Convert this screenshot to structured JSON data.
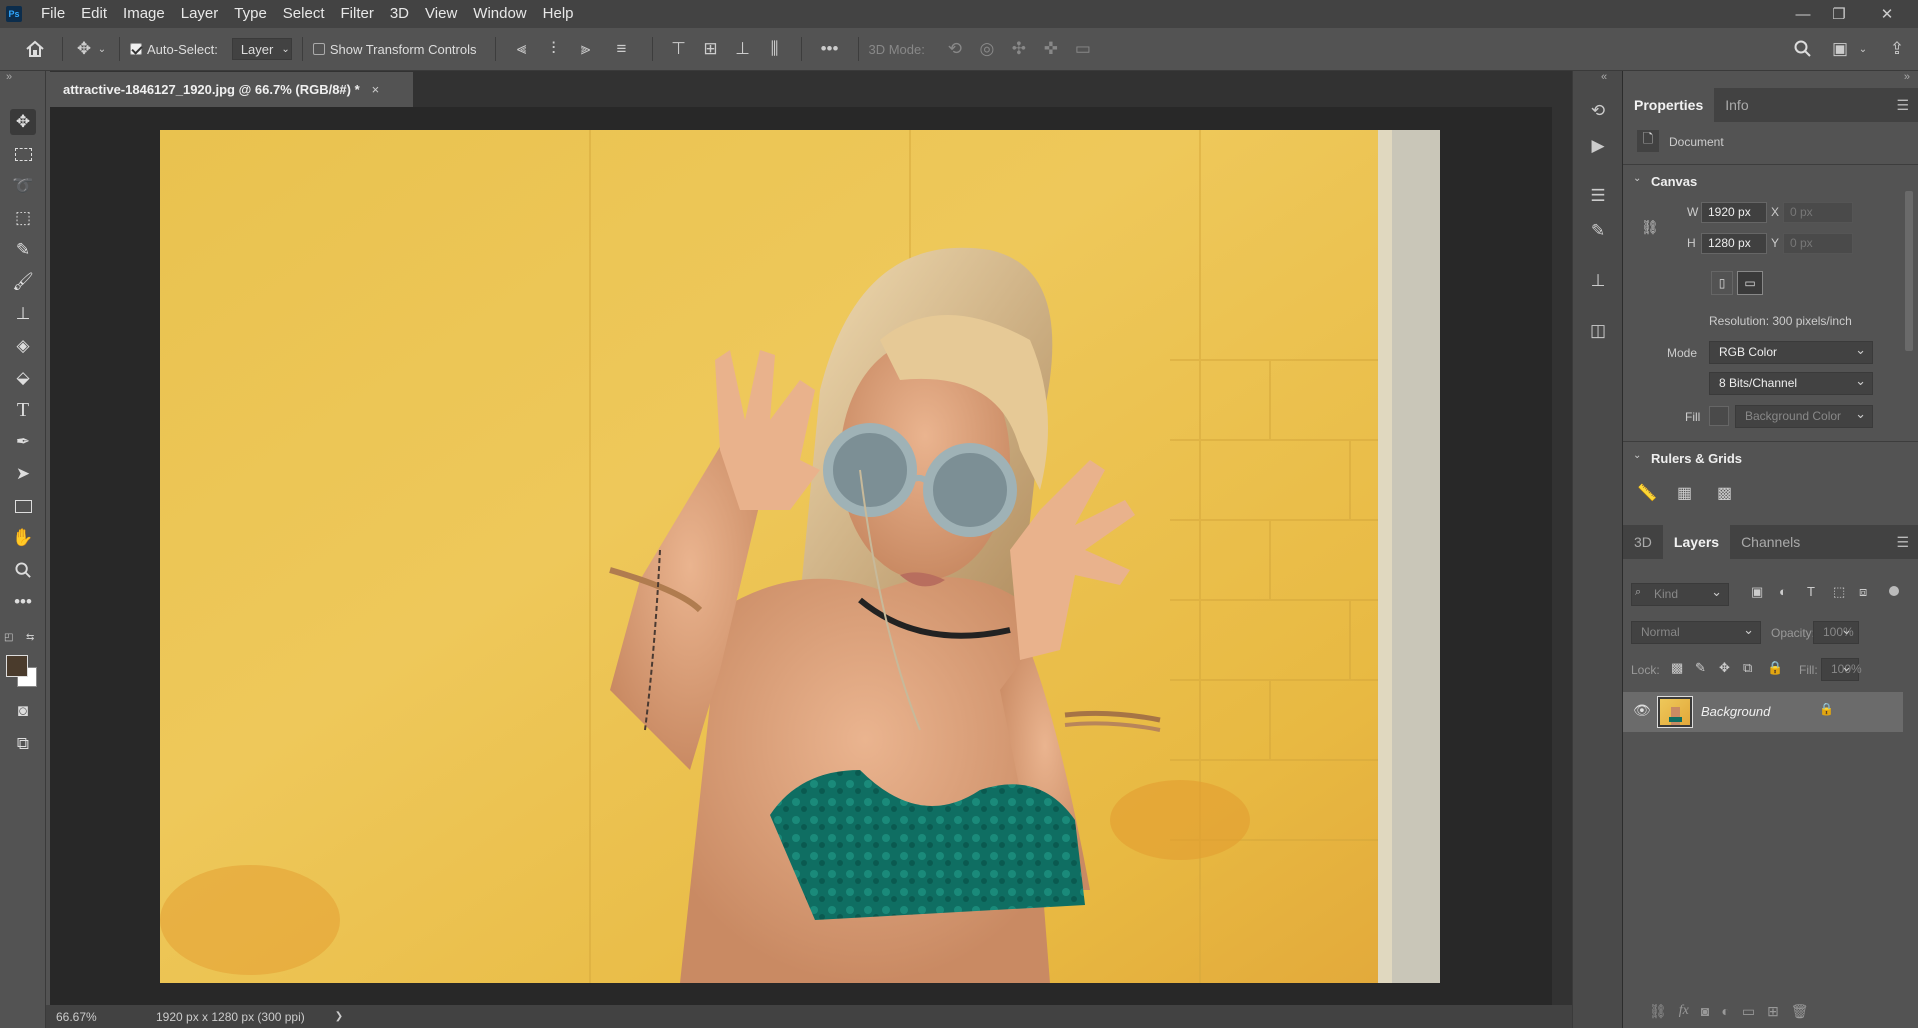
{
  "menubar": {
    "logo": "Ps",
    "items": [
      "File",
      "Edit",
      "Image",
      "Layer",
      "Type",
      "Select",
      "Filter",
      "3D",
      "View",
      "Window",
      "Help"
    ]
  },
  "options_bar": {
    "auto_select_label": "Auto-Select:",
    "auto_select_target": "Layer",
    "show_transform_label": "Show Transform Controls",
    "mode_3d_label": "3D Mode:",
    "more": "•••"
  },
  "document": {
    "tab_title": "attractive-1846127_1920.jpg @ 66.7% (RGB/8#) *",
    "close": "×"
  },
  "status": {
    "zoom": "66.67%",
    "info": "1920 px x 1280 px (300 ppi)",
    "arrow": "❯"
  },
  "properties_panel": {
    "tabs": [
      "Properties",
      "Info"
    ],
    "doc_label": "Document",
    "canvas_section": "Canvas",
    "w_label": "W",
    "w_value": "1920 px",
    "h_label": "H",
    "h_value": "1280 px",
    "x_label": "X",
    "x_placeholder": "0 px",
    "y_label": "Y",
    "y_placeholder": "0 px",
    "resolution": "Resolution: 300 pixels/inch",
    "mode_label": "Mode",
    "mode_value": "RGB Color",
    "bits_value": "8 Bits/Channel",
    "fill_label": "Fill",
    "fill_value": "Background Color",
    "rulers_section": "Rulers & Grids"
  },
  "layers_panel": {
    "tabs": [
      "3D",
      "Layers",
      "Channels"
    ],
    "kind_placeholder": "Kind",
    "blend_mode": "Normal",
    "opacity_label": "Opacity:",
    "opacity_value": "100%",
    "lock_label": "Lock:",
    "fill_label": "Fill:",
    "fill_value": "100%",
    "layers": [
      {
        "name": "Background",
        "visible": true,
        "locked": true
      }
    ]
  },
  "colors": {
    "accent": "#31a8ff",
    "canvas_bg": "#282828",
    "panel_bg": "#535353",
    "foreground_swatch": "#4a3b2c",
    "background_swatch": "#ffffff"
  }
}
